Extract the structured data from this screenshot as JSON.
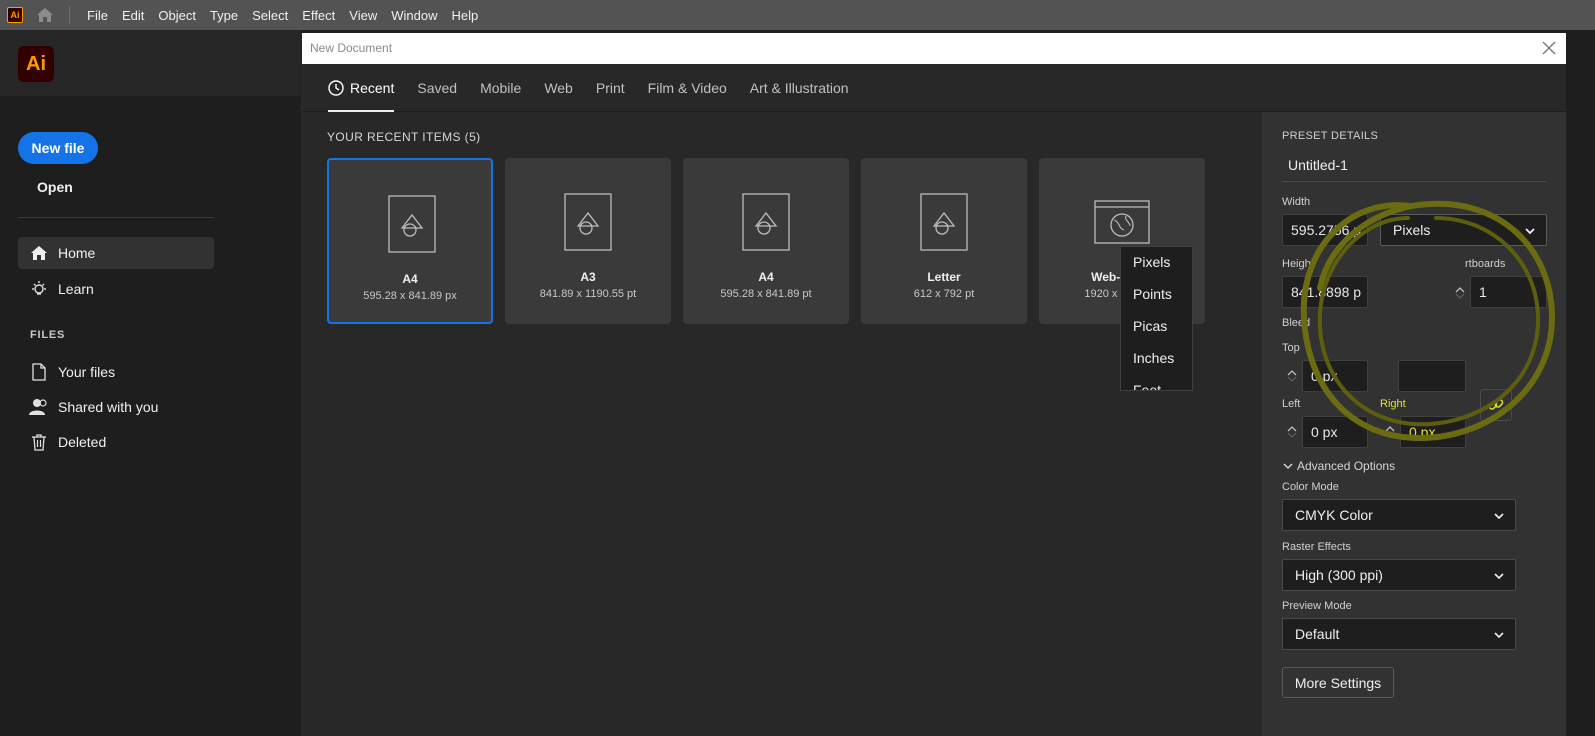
{
  "menubar": {
    "app_badge": "Ai",
    "items": [
      "File",
      "Edit",
      "Object",
      "Type",
      "Select",
      "Effect",
      "View",
      "Window",
      "Help"
    ]
  },
  "sidebar": {
    "logo": "Ai",
    "new_file": "New file",
    "open": "Open",
    "nav": [
      {
        "label": "Home",
        "icon": "home-icon",
        "active": true
      },
      {
        "label": "Learn",
        "icon": "lightbulb-icon"
      }
    ],
    "files_heading": "FILES",
    "files": [
      {
        "label": "Your files",
        "icon": "file-icon"
      },
      {
        "label": "Shared with you",
        "icon": "people-icon"
      },
      {
        "label": "Deleted",
        "icon": "trash-icon"
      }
    ]
  },
  "dialog": {
    "title": "New Document",
    "tabs": [
      "Recent",
      "Saved",
      "Mobile",
      "Web",
      "Print",
      "Film & Video",
      "Art & Illustration"
    ],
    "recent_heading": "YOUR RECENT ITEMS",
    "recent_count": "(5)",
    "recent_items": [
      {
        "name": "A4",
        "size": "595.28 x 841.89 px",
        "selected": true
      },
      {
        "name": "A3",
        "size": "841.89 x 1190.55 pt"
      },
      {
        "name": "A4",
        "size": "595.28 x 841.89 pt"
      },
      {
        "name": "Letter",
        "size": "612 x 792 pt"
      },
      {
        "name": "Web-Large",
        "size": "1920 x 1080 px"
      }
    ]
  },
  "preset": {
    "heading": "PRESET DETAILS",
    "doc_name": "Untitled-1",
    "width_label": "Width",
    "width_value": "595.2756 p",
    "units_value": "Pixels",
    "units_options": [
      "Pixels",
      "Points",
      "Picas",
      "Inches",
      "Feet"
    ],
    "height_label": "Height",
    "height_value": "841.8898 p",
    "artboards_label": "rtboards",
    "artboards_value": "1",
    "bleed_label": "Bleed",
    "top_label": "Top",
    "top_value": "0 px",
    "left_label": "Left",
    "left_value": "0 px",
    "right_label": "Right",
    "right_value": "0 px",
    "advanced_label": "Advanced Options",
    "color_mode_label": "Color Mode",
    "color_mode_value": "CMYK Color",
    "raster_label": "Raster Effects",
    "raster_value": "High (300 ppi)",
    "preview_label": "Preview Mode",
    "preview_value": "Default",
    "more_settings": "More Settings"
  },
  "colors": {
    "accent": "#1473e6",
    "ai_brand": "#ff9a00",
    "highlight_yellow": "#e5e22a",
    "annotation": "#6b6b12"
  }
}
